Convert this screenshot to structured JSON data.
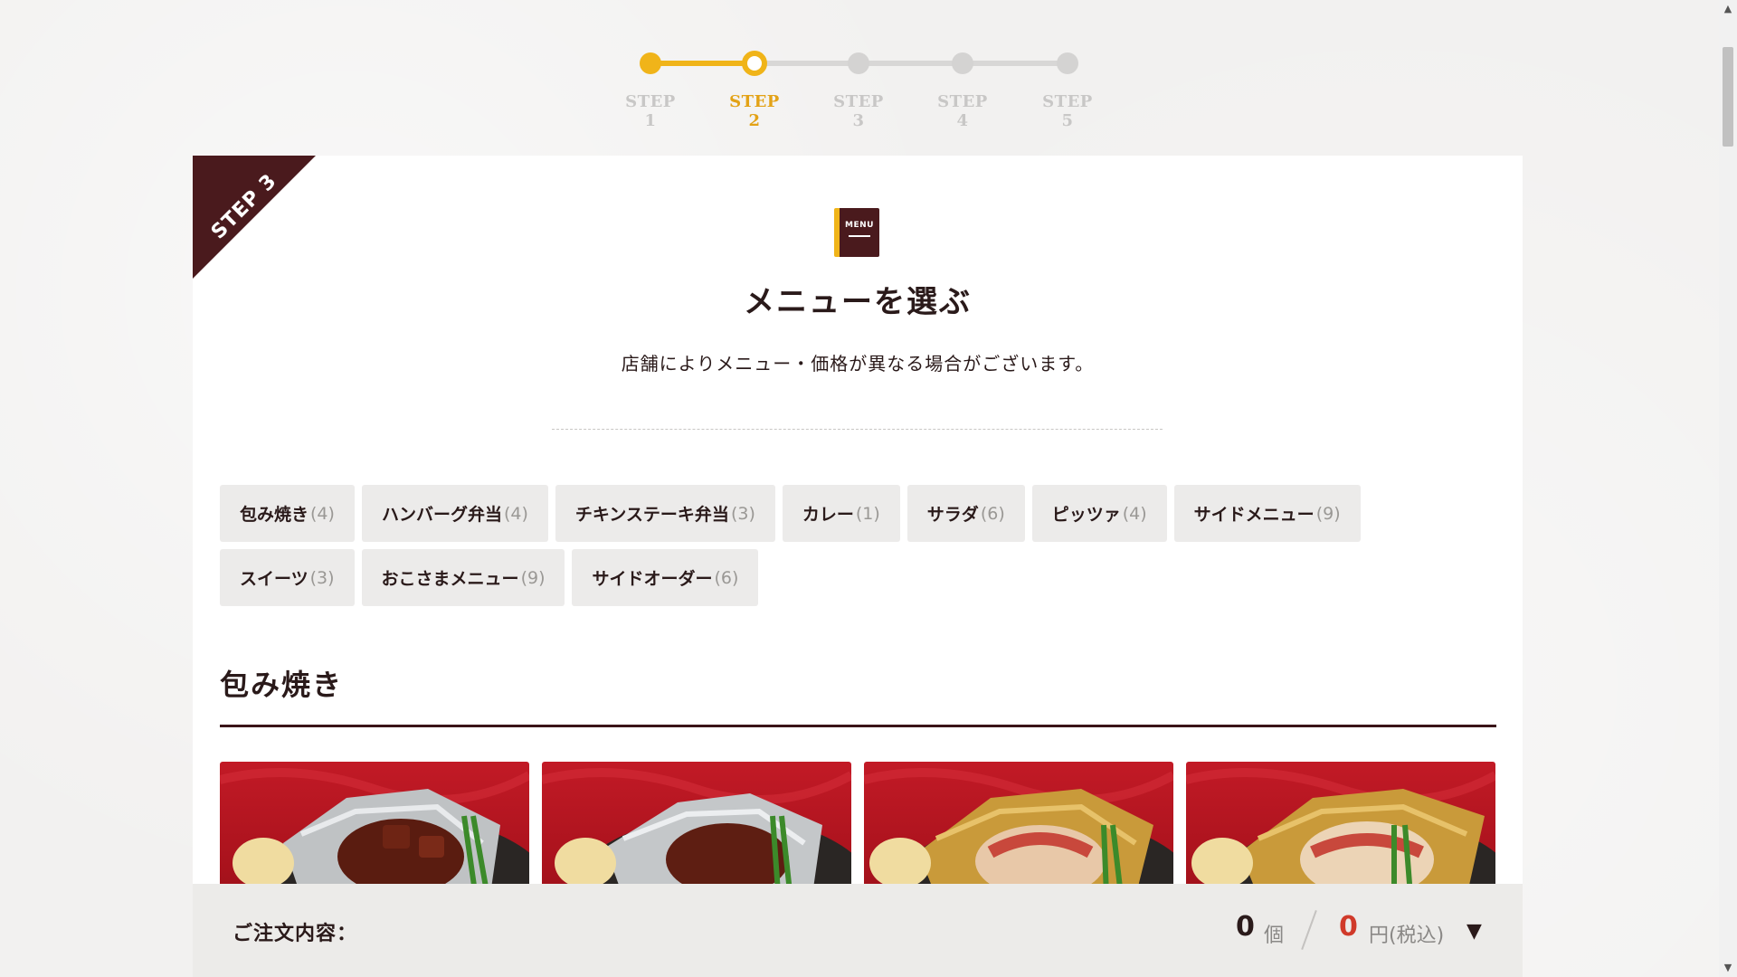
{
  "stepper": {
    "steps": [
      {
        "label": "STEP 1",
        "state": "done"
      },
      {
        "label": "STEP 2",
        "state": "current"
      },
      {
        "label": "STEP 3",
        "state": "todo"
      },
      {
        "label": "STEP 4",
        "state": "todo"
      },
      {
        "label": "STEP 5",
        "state": "todo"
      }
    ]
  },
  "card": {
    "ribbon": "STEP 3",
    "icon_text": "MENU",
    "title": "メニューを選ぶ",
    "subtitle": "店舗によりメニュー・価格が異なる場合がございます。"
  },
  "categories": {
    "row1": [
      {
        "label": "包み焼き",
        "count": "(4)"
      },
      {
        "label": "ハンバーグ弁当",
        "count": "(4)"
      },
      {
        "label": "チキンステーキ弁当",
        "count": "(3)"
      },
      {
        "label": "カレー",
        "count": "(1)"
      },
      {
        "label": "サラダ",
        "count": "(6)"
      },
      {
        "label": "ピッツァ",
        "count": "(4)"
      },
      {
        "label": "サイドメニュー",
        "count": "(9)"
      }
    ],
    "row2": [
      {
        "label": "スイーツ",
        "count": "(3)"
      },
      {
        "label": "おこさまメニュー",
        "count": "(9)"
      },
      {
        "label": "サイドオーダー",
        "count": "(6)"
      }
    ]
  },
  "section": {
    "title": "包み焼き"
  },
  "order_bar": {
    "label": "ご注文内容：",
    "quantity": "0",
    "quantity_unit": "個",
    "price": "0",
    "price_unit": "円(税込)",
    "toggle": "▼"
  },
  "colors": {
    "accent": "#f0b419",
    "brand_dark": "#4a1a1d",
    "price_red": "#d03a2a"
  }
}
